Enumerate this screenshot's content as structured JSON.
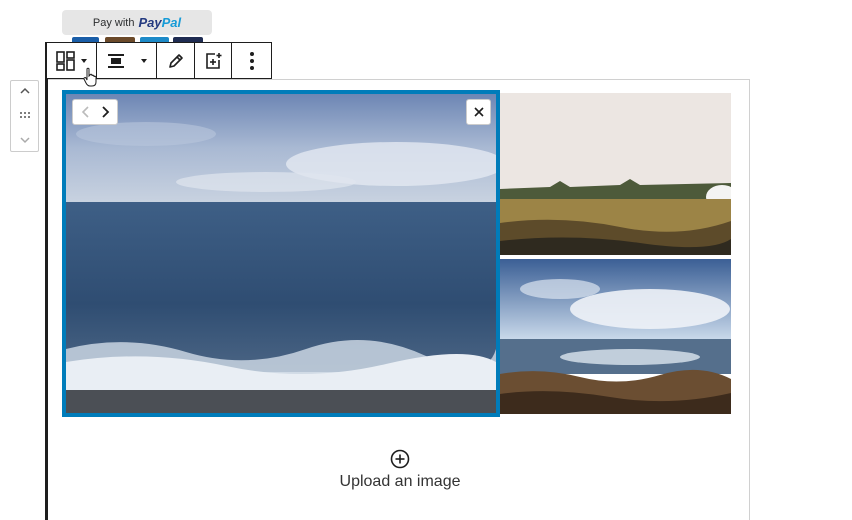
{
  "paypal": {
    "prefix": "Pay with",
    "brand_dark": "Pay",
    "brand_light": "Pal",
    "card_colors": [
      "#1a5ea8",
      "#6b4a2a",
      "#1d8ac8",
      "#1f2c52"
    ]
  },
  "toolbar": {
    "items": [
      {
        "name": "change-block-type",
        "icon": "gallery-icon"
      },
      {
        "name": "change-alignment",
        "icon": "align-center-icon"
      },
      {
        "name": "edit",
        "icon": "pencil-icon"
      },
      {
        "name": "add-image",
        "icon": "add-media-icon"
      },
      {
        "name": "more-options",
        "icon": "vertical-ellipsis-icon"
      }
    ]
  },
  "mover": {
    "up": "chevron-up-icon",
    "drag": "drag-handle-icon",
    "down": "chevron-down-icon"
  },
  "gallery": {
    "images": [
      {
        "subject": "sea-waves",
        "selected": true
      },
      {
        "subject": "field-landscape",
        "selected": false
      },
      {
        "subject": "rocky-coast",
        "selected": false
      }
    ]
  },
  "upload": {
    "label": "Upload an image",
    "icon": "plus-circle-icon"
  },
  "colors": {
    "accent": "#007cba",
    "paypal_dark": "#253b80",
    "paypal_light": "#179bd7"
  }
}
